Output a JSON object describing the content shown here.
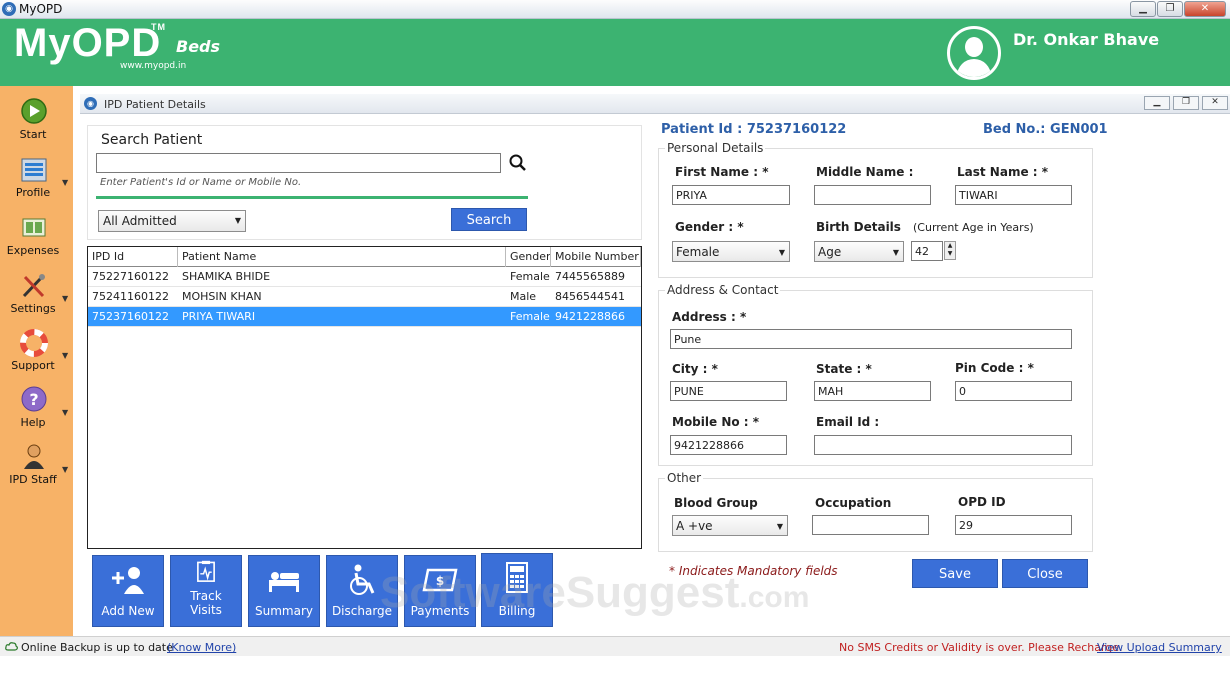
{
  "window": {
    "title": "MyOPD",
    "icon_name": "myopd-icon"
  },
  "header": {
    "logo_text": "MyOPD",
    "logo_tm": "TM",
    "logo_site": "www.myopd.in",
    "logo_sub": "Beds",
    "doctor_name": "Dr. Onkar Bhave",
    "bg_color": "#3cb371"
  },
  "sidebar": {
    "bg_color": "#f7b267",
    "items": [
      {
        "label": "Start",
        "icon": "play-icon"
      },
      {
        "label": "Profile",
        "icon": "profile-list-icon"
      },
      {
        "label": "Expenses",
        "icon": "expenses-icon"
      },
      {
        "label": "Settings",
        "icon": "tools-icon"
      },
      {
        "label": "Support",
        "icon": "lifebuoy-icon"
      },
      {
        "label": "Help",
        "icon": "question-icon"
      },
      {
        "label": "IPD Staff",
        "icon": "staff-icon"
      }
    ]
  },
  "subwindow": {
    "title": "IPD Patient Details"
  },
  "search": {
    "title": "Search Patient",
    "value": "",
    "hint": "Enter Patient's Id or Name or Mobile No.",
    "filter_selected": "All Admitted",
    "button_label": "Search"
  },
  "table": {
    "headers": [
      "IPD Id",
      "Patient Name",
      "Gender",
      "Mobile Number"
    ],
    "rows": [
      {
        "id": "75227160122",
        "name": "SHAMIKA BHIDE",
        "gender": "Female",
        "mobile": "7445565889",
        "selected": false
      },
      {
        "id": "75241160122",
        "name": "MOHSIN KHAN",
        "gender": "Male",
        "mobile": "8456544541",
        "selected": false
      },
      {
        "id": "75237160122",
        "name": "PRIYA TIWARI",
        "gender": "Female",
        "mobile": "9421228866",
        "selected": true
      }
    ]
  },
  "actions": [
    {
      "label": "Add New",
      "icon": "add-user-icon"
    },
    {
      "label": "Track Visits",
      "line1": "Track",
      "line2": "Visits",
      "icon": "clipboard-icon"
    },
    {
      "label": "Summary",
      "icon": "bed-icon"
    },
    {
      "label": "Discharge",
      "icon": "wheelchair-icon"
    },
    {
      "label": "Payments",
      "icon": "payment-card-icon"
    },
    {
      "label": "Billing",
      "icon": "calculator-icon"
    }
  ],
  "patient": {
    "id_label": "Patient Id : 75237160122",
    "bed_label": "Bed No.: GEN001"
  },
  "personal": {
    "title": "Personal Details",
    "first_name_label": "First Name :  *",
    "first_name": "PRIYA",
    "middle_name_label": "Middle Name :",
    "middle_name": "",
    "last_name_label": "Last Name :  *",
    "last_name": "TIWARI",
    "gender_label": "Gender :  *",
    "gender": "Female",
    "birth_label": "Birth Details",
    "birth_type": "Age",
    "age_hint": "(Current Age in Years)",
    "age": "42"
  },
  "address": {
    "title": "Address & Contact",
    "address_label": "Address  :  *",
    "address": "Pune",
    "city_label": "City :  *",
    "city": "PUNE",
    "state_label": "State :  *",
    "state": "MAH",
    "pin_label": "Pin Code :  *",
    "pin": "0",
    "mobile_label": "Mobile No :  *",
    "mobile": "9421228866",
    "email_label": "Email Id :",
    "email": ""
  },
  "other": {
    "title": "Other",
    "blood_label": "Blood Group",
    "blood": "A +ve",
    "occupation_label": "Occupation",
    "occupation": "",
    "opd_label": "OPD ID",
    "opd": "29"
  },
  "form": {
    "mandatory_note": "* Indicates Mandatory fields",
    "save_label": "Save",
    "close_label": "Close"
  },
  "watermark": {
    "main": "SoftwareSuggest",
    "suffix": ".com"
  },
  "status": {
    "backup": "Online Backup is up to date",
    "know_more": "(Know More)",
    "sms": "No SMS Credits or Validity is over. Please Recharge.",
    "upload": "View Upload Summary"
  }
}
